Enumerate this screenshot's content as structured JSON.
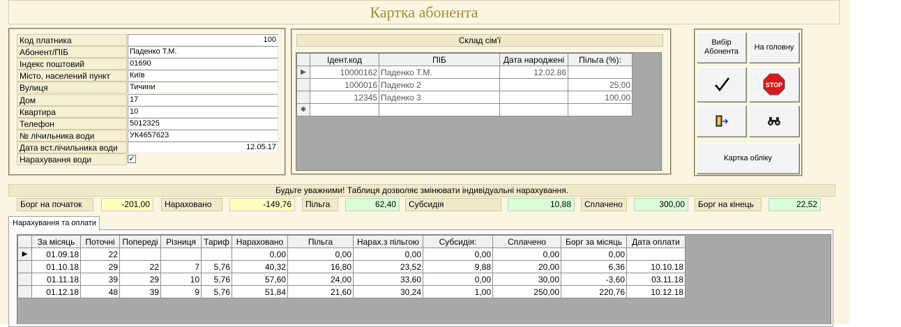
{
  "title": "Картка абонента",
  "payer": {
    "fields": [
      {
        "label": "Код платника",
        "value": "100",
        "align": "r"
      },
      {
        "label": "Абонент/ПІБ",
        "value": "Паденко Т.М.",
        "align": "l"
      },
      {
        "label": "Індекс поштовий",
        "value": "01690",
        "align": "l"
      },
      {
        "label": "Місто, населений пункт",
        "value": "Київ",
        "align": "l"
      },
      {
        "label": "Вулиця",
        "value": "Тичини",
        "align": "l"
      },
      {
        "label": "Дом",
        "value": "17",
        "align": "l"
      },
      {
        "label": "Квартира",
        "value": "10",
        "align": "l"
      },
      {
        "label": "Телефон",
        "value": "5012325",
        "align": "l"
      },
      {
        "label": "№ лічильника води",
        "value": "УК4657623",
        "align": "l"
      },
      {
        "label": "Дата вст.лічильника води",
        "value": "12.05.17",
        "align": "r"
      }
    ],
    "water_charge_label": "Нарахування води",
    "water_charge_checked": true
  },
  "family": {
    "title": "Склад сім'ї",
    "columns": [
      "Ідент.код",
      "ПІБ",
      "Дата народжені",
      "Пільга (%):"
    ],
    "rows": [
      {
        "marker": "▶",
        "cells": [
          "10000162",
          "Паденко Т.М.",
          "12.02.86",
          ""
        ]
      },
      {
        "marker": "",
        "cells": [
          "1000016",
          "Паденко 2",
          "",
          "25,00"
        ]
      },
      {
        "marker": "",
        "cells": [
          "12345",
          "Паденко 3",
          "",
          "100,00"
        ]
      },
      {
        "marker": "✱",
        "cells": [
          "",
          "",
          "",
          ""
        ]
      }
    ]
  },
  "buttons": {
    "select_subscriber": "Вибір Абонента",
    "home": "На головну",
    "confirm_icon": "checkmark-icon",
    "stop_icon": "stop-sign-icon",
    "stop_text": "STOP",
    "exit_icon": "door-exit-icon",
    "find_icon": "binoculars-icon",
    "account_card": "Картка обліку"
  },
  "warning": "Будьте уважними! Таблиця дозволяє змінювати індивідуальні нарахування.",
  "summary": [
    {
      "label": "Борг на початок",
      "value": "-201,00",
      "color": "#ffffc0"
    },
    {
      "label": "Нараховано",
      "value": "-149,76",
      "color": "#ffffc0"
    },
    {
      "label": "Пільга",
      "value": "62,40",
      "color": "#d8ffd8"
    },
    {
      "label": "Субсидія",
      "value": "10,88",
      "color": "#d8ffd8"
    },
    {
      "label": "Сплачено",
      "value": "300,00",
      "color": "#d8ffd8"
    },
    {
      "label": "Борг на кінець",
      "value": "22,52",
      "color": "#d8ffd8"
    }
  ],
  "tab_label": "Нарахування та оплати",
  "charges": {
    "columns": [
      "За місяць",
      "Поточні",
      "Попереді",
      "Різниця",
      "Тариф",
      "Нараховано",
      "Пільга",
      "Нарах.з пільгою",
      "Субсидія:",
      "Сплачено",
      "Борг за місяць",
      "Дата оплати"
    ],
    "rows": [
      {
        "marker": "▶",
        "cells": [
          "01.09.18",
          "22",
          "",
          "",
          "",
          "0,00",
          "0,00",
          "0,00",
          "0,00",
          "0,00",
          "0,00",
          ""
        ]
      },
      {
        "marker": "",
        "cells": [
          "01.10.18",
          "29",
          "22",
          "7",
          "5,76",
          "40,32",
          "16,80",
          "23,52",
          "9,88",
          "20,00",
          "6,36",
          "10.10.18"
        ]
      },
      {
        "marker": "",
        "cells": [
          "01.11.18",
          "39",
          "29",
          "10",
          "5,76",
          "57,60",
          "24,00",
          "33,60",
          "0,00",
          "30,00",
          "-3,60",
          "03.11.18"
        ]
      },
      {
        "marker": "",
        "cells": [
          "01.12.18",
          "48",
          "39",
          "9",
          "5,76",
          "51,84",
          "21,60",
          "30,24",
          "1,00",
          "250,00",
          "220,76",
          "10.12.18"
        ]
      }
    ]
  }
}
